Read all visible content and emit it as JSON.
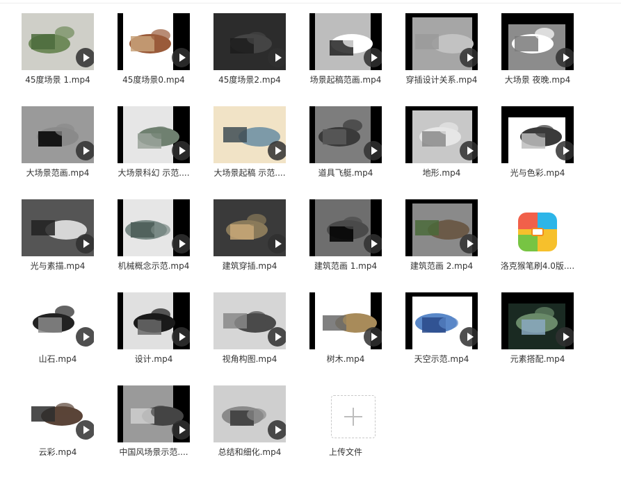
{
  "files": [
    {
      "name": "45度场景 1.mp4",
      "icon": "video-thumbnail",
      "colors": [
        "#cfcfc8",
        "#6f8a5a",
        "#4c6b3d"
      ]
    },
    {
      "name": "45度场景0.mp4",
      "icon": "video-thumbnail",
      "colors": [
        "#ffffff",
        "#9a5b3a",
        "#c8a27a"
      ]
    },
    {
      "name": "45度场景2.mp4",
      "icon": "video-thumbnail",
      "colors": [
        "#2c2c2c",
        "#444444",
        "#1c1c1c"
      ]
    },
    {
      "name": "场景起稿范画.mp4",
      "icon": "video-thumbnail",
      "colors": [
        "#bdbdbd",
        "#ffffff",
        "#222222"
      ]
    },
    {
      "name": "穿插设计关系.mp4",
      "icon": "video-thumbnail",
      "colors": [
        "#a6a6a6",
        "#c2c2c2",
        "#9a9a9a"
      ]
    },
    {
      "name": "大场景 夜晚.mp4",
      "icon": "video-thumbnail",
      "colors": [
        "#8c8c8c",
        "#ffffff",
        "#7a7a7a"
      ]
    },
    {
      "name": "大场景范画.mp4",
      "icon": "video-thumbnail",
      "colors": [
        "#9a9a9a",
        "#8a8a8a",
        "#000000"
      ]
    },
    {
      "name": "大场景科幻 示范....",
      "icon": "video-thumbnail",
      "colors": [
        "#e6e6e6",
        "#6f8070",
        "#9aa39a"
      ]
    },
    {
      "name": "大场景起稿 示范....",
      "icon": "video-thumbnail",
      "colors": [
        "#f1e3c6",
        "#7d9aa8",
        "#3f4d55"
      ]
    },
    {
      "name": "道具飞艇.mp4",
      "icon": "video-thumbnail",
      "colors": [
        "#7d7d7d",
        "#3a3a3a",
        "#5a5a5a"
      ]
    },
    {
      "name": "地形.mp4",
      "icon": "video-thumbnail",
      "colors": [
        "#c8c8c8",
        "#e6e6e6",
        "#8a8a8a"
      ]
    },
    {
      "name": "光与色彩.mp4",
      "icon": "video-thumbnail",
      "colors": [
        "#ffffff",
        "#3a3a3a",
        "#bdbdbd"
      ]
    },
    {
      "name": "光与素描.mp4",
      "icon": "video-thumbnail",
      "colors": [
        "#555555",
        "#d6d6d6",
        "#222222"
      ]
    },
    {
      "name": "机械概念示范.mp4",
      "icon": "video-thumbnail",
      "colors": [
        "#e6e6e6",
        "#7a8a86",
        "#4a5a56"
      ]
    },
    {
      "name": "建筑穿插.mp4",
      "icon": "video-thumbnail",
      "colors": [
        "#3a3a3a",
        "#8a7a5a",
        "#c8a878"
      ]
    },
    {
      "name": "建筑范画 1.mp4",
      "icon": "video-thumbnail",
      "colors": [
        "#6e6e6e",
        "#4a4a4a",
        "#000000"
      ]
    },
    {
      "name": "建筑范画 2.mp4",
      "icon": "video-thumbnail",
      "colors": [
        "#8a8a8a",
        "#6b5a48",
        "#4a6a3a"
      ]
    },
    {
      "name": "洛克猴笔刷4.0版....",
      "icon": "app-icon",
      "colors": [
        "#f1604a",
        "#2db5e8",
        "#77c443",
        "#f6c02c"
      ]
    },
    {
      "name": "山石.mp4",
      "icon": "video-thumbnail",
      "colors": [
        "#ffffff",
        "#222222",
        "#8a8a8a"
      ]
    },
    {
      "name": "设计.mp4",
      "icon": "video-thumbnail",
      "colors": [
        "#e0e0e0",
        "#1a1a1a",
        "#6a6a6a"
      ]
    },
    {
      "name": "视角构图.mp4",
      "icon": "video-thumbnail",
      "colors": [
        "#d6d6d6",
        "#4a4a4a",
        "#888888"
      ]
    },
    {
      "name": "树木.mp4",
      "icon": "video-thumbnail",
      "colors": [
        "#ffffff",
        "#a88b5a",
        "#6a6a6a"
      ]
    },
    {
      "name": "天空示范.mp4",
      "icon": "video-thumbnail",
      "colors": [
        "#ffffff",
        "#5a88c8",
        "#2a4a8a"
      ]
    },
    {
      "name": "元素搭配.mp4",
      "icon": "video-thumbnail",
      "colors": [
        "#1a2a22",
        "#6a8a6a",
        "#8aa8c0"
      ]
    },
    {
      "name": "云彩.mp4",
      "icon": "video-thumbnail",
      "colors": [
        "#ffffff",
        "#5a4438",
        "#2e2e2e"
      ]
    },
    {
      "name": "中国风场景示范....",
      "icon": "video-thumbnail",
      "colors": [
        "#9a9a9a",
        "#444444",
        "#cfcfcf"
      ]
    },
    {
      "name": "总结和细化.mp4",
      "icon": "video-thumbnail",
      "colors": [
        "#cfcfcf",
        "#8a8a8a",
        "#3a3a3a"
      ]
    },
    {
      "name": "上传文件",
      "icon": "plus-icon",
      "colors": [
        "#bdbdbd"
      ]
    }
  ]
}
